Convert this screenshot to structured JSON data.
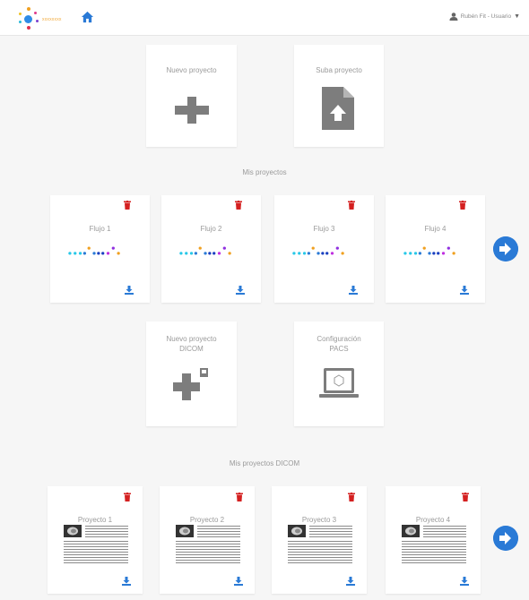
{
  "header": {
    "logo_text": "xxxxxxxx",
    "user_label": "Rubén Fit - Usuario",
    "caret": "▼"
  },
  "actions_top": {
    "new_project": "Nuevo proyecto",
    "upload_project": "Suba proyecto"
  },
  "my_projects": {
    "title": "Mis proyectos",
    "items": [
      {
        "label": "Flujo 1"
      },
      {
        "label": "Flujo 2"
      },
      {
        "label": "Flujo 3"
      },
      {
        "label": "Flujo 4"
      }
    ]
  },
  "actions_dicom": {
    "new_dicom_line1": "Nuevo proyecto",
    "new_dicom_line2": "DICOM",
    "pacs_line1": "Configuración",
    "pacs_line2": "PACS"
  },
  "my_dicom_projects": {
    "title": "Mis proyectos DICOM",
    "items": [
      {
        "label": "Proyecto 1"
      },
      {
        "label": "Proyecto 2"
      },
      {
        "label": "Proyecto 3"
      },
      {
        "label": "Proyecto 4"
      }
    ]
  },
  "colors": {
    "accent_blue": "#2a7ad6",
    "trash_red": "#d42020",
    "icon_grey": "#7d7d7d"
  },
  "icons": {
    "home": "home-icon",
    "user": "user-icon",
    "plus": "plus-icon",
    "upload_file": "file-upload-icon",
    "trash": "trash-icon",
    "download": "download-icon",
    "next": "arrow-right-circle-icon",
    "pacs": "laptop-icon"
  }
}
